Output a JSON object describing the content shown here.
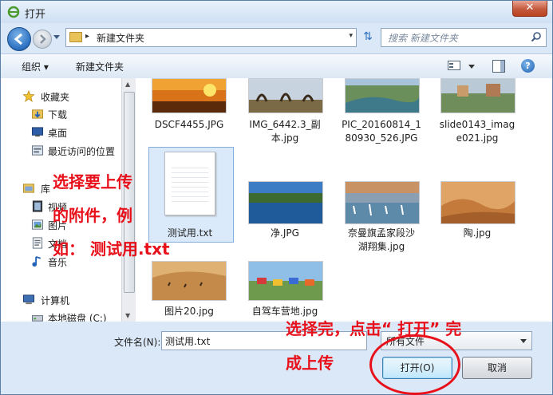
{
  "window": {
    "title": "打开",
    "close_glyph": "✕"
  },
  "nav": {
    "path": "新建文件夹",
    "search_placeholder": "搜索 新建文件夹",
    "refresh_glyph": "⇅",
    "path_arrow": "▸",
    "drop_glyph": "▾"
  },
  "toolbar": {
    "organize_label": "组织 ▾",
    "new_folder_label": "新建文件夹",
    "help_label": "?"
  },
  "sidebar": {
    "favorites_header": "收藏夹",
    "items": [
      {
        "label": "下载",
        "icon": "download-folder-icon"
      },
      {
        "label": "桌面",
        "icon": "desktop-icon"
      },
      {
        "label": "最近访问的位置",
        "icon": "recent-places-icon"
      }
    ],
    "library_header": "库",
    "library_items": [
      {
        "label": "视频",
        "icon": "video-library-icon"
      },
      {
        "label": "图片",
        "icon": "pictures-library-icon"
      },
      {
        "label": "文档",
        "icon": "documents-library-icon"
      },
      {
        "label": "音乐",
        "icon": "music-library-icon"
      }
    ],
    "computer_header": "计算机",
    "computer_items": [
      {
        "label": "本地磁盘 (C:)",
        "icon": "local-disk-icon"
      }
    ]
  },
  "files": [
    {
      "name": "DSCF4455.JPG"
    },
    {
      "name": "IMG_6442.3_副本.jpg",
      "line1": "IMG_6442.3_副",
      "line2": "本.jpg"
    },
    {
      "name": "PIC_20160814_180930_526.JPG",
      "line1": "PIC_20160814_1",
      "line2": "80930_526.JPG"
    },
    {
      "name": "slide0143_image021.jpg",
      "line1": "slide0143_imag",
      "line2": "e021.jpg"
    },
    {
      "name": "测试用.txt"
    },
    {
      "name": "净.JPG"
    },
    {
      "name": "奈曼旗孟家段沙湖翔集.jpg",
      "line1": "奈曼旗孟家段沙",
      "line2": "湖翔集.jpg"
    },
    {
      "name": "陶.jpg"
    },
    {
      "name": "图片20.jpg"
    },
    {
      "name": "自驾车营地.jpg"
    }
  ],
  "bottom": {
    "filename_label": "文件名(N):",
    "filename_value": "测试用.txt",
    "filetype_value": "所有文件",
    "open_button": "打开(O)",
    "cancel_button": "取消"
  },
  "annotations": {
    "left_line1": "选择要上传",
    "left_line2": "的附件，例",
    "left_line3": "如： 测试用.txt",
    "right_line1": "选择完，点击“ 打开” 完",
    "right_line2": "成上传"
  },
  "colors": {
    "annotation": "#e8101a",
    "window_frame": "#dbe8f7"
  }
}
